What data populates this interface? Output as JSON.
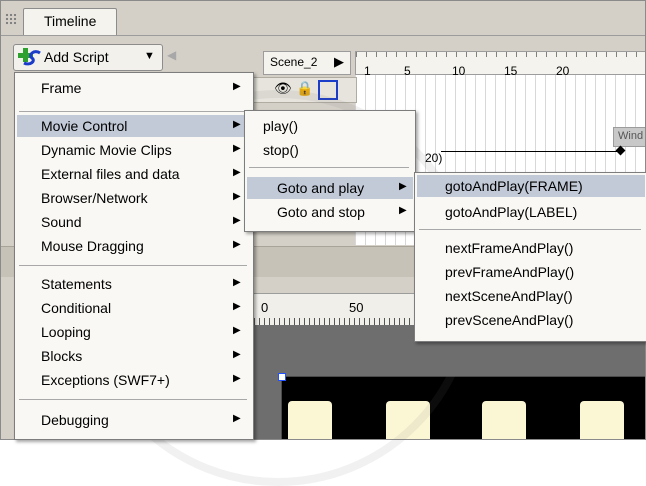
{
  "window": {
    "tab_title": "Timeline"
  },
  "toolbar": {
    "add_script_label": "Add Script"
  },
  "timeline": {
    "scene_name": "Scene_2",
    "ruler_ticks": [
      "1",
      "5",
      "10",
      "15",
      "20"
    ],
    "layer_label": "Wind",
    "tween_label": "20)"
  },
  "stage_ruler": {
    "ticks": [
      "0",
      "50"
    ]
  },
  "menu_main": {
    "items": [
      {
        "label": "Frame"
      },
      {
        "label": "Movie Control"
      },
      {
        "label": "Dynamic Movie Clips"
      },
      {
        "label": "External files and data"
      },
      {
        "label": "Browser/Network"
      },
      {
        "label": "Sound"
      },
      {
        "label": "Mouse Dragging"
      },
      {
        "label": "Statements"
      },
      {
        "label": "Conditional"
      },
      {
        "label": "Looping"
      },
      {
        "label": "Blocks"
      },
      {
        "label": "Exceptions (SWF7+)"
      },
      {
        "label": "Debugging"
      }
    ]
  },
  "menu_movie_control": {
    "items": [
      {
        "label": "play()"
      },
      {
        "label": "stop()"
      },
      {
        "label": "Goto and play"
      },
      {
        "label": "Goto and stop"
      }
    ]
  },
  "menu_goto_play": {
    "items": [
      {
        "label": "gotoAndPlay(FRAME)"
      },
      {
        "label": "gotoAndPlay(LABEL)"
      },
      {
        "label": "nextFrameAndPlay()"
      },
      {
        "label": "prevFrameAndPlay()"
      },
      {
        "label": "nextSceneAndPlay()"
      },
      {
        "label": "prevSceneAndPlay()"
      }
    ]
  },
  "colors": {
    "menu_highlight": "#c2cad8",
    "stage": "#000000",
    "stage_bars": "#fbf6d4"
  }
}
